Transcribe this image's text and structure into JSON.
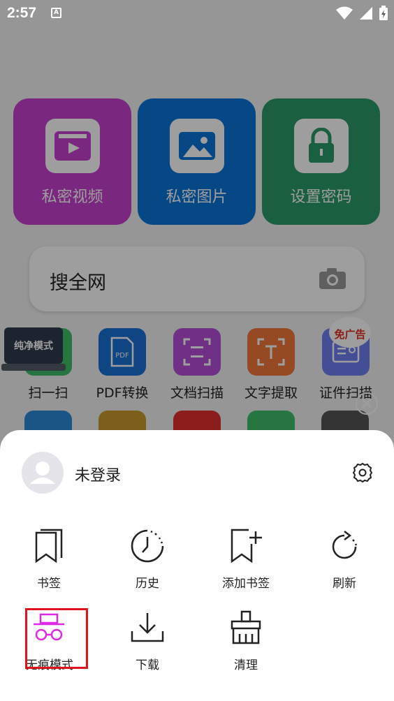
{
  "status_bar": {
    "time": "2:57",
    "notif_letter": "A"
  },
  "home": {
    "tiles": [
      {
        "label": "私密视频",
        "color": "#c63fce"
      },
      {
        "label": "私密图片",
        "color": "#0a73d8"
      },
      {
        "label": "设置密码",
        "color": "#2a9a67"
      }
    ],
    "search": {
      "label": "搜全网"
    },
    "tools": [
      {
        "label": "扫一扫",
        "color": "#3fbf6a"
      },
      {
        "label": "PDF转换",
        "color": "#1a70d6"
      },
      {
        "label": "文档扫描",
        "color": "#b54ed8"
      },
      {
        "label": "文字提取",
        "color": "#f0783a"
      },
      {
        "label": "证件扫描",
        "color": "#6f7ff0"
      }
    ],
    "pure_mode_badge": "纯净模式",
    "ad_badge": "免广告"
  },
  "sheet": {
    "login_label": "未登录",
    "menu": [
      {
        "label": "书签"
      },
      {
        "label": "历史"
      },
      {
        "label": "添加书签"
      },
      {
        "label": "刷新"
      },
      {
        "label": "无痕模式"
      },
      {
        "label": "下载"
      },
      {
        "label": "清理"
      }
    ]
  },
  "colors": {
    "incognito_accent": "#e028e8",
    "highlight_box": "#e0141e"
  }
}
